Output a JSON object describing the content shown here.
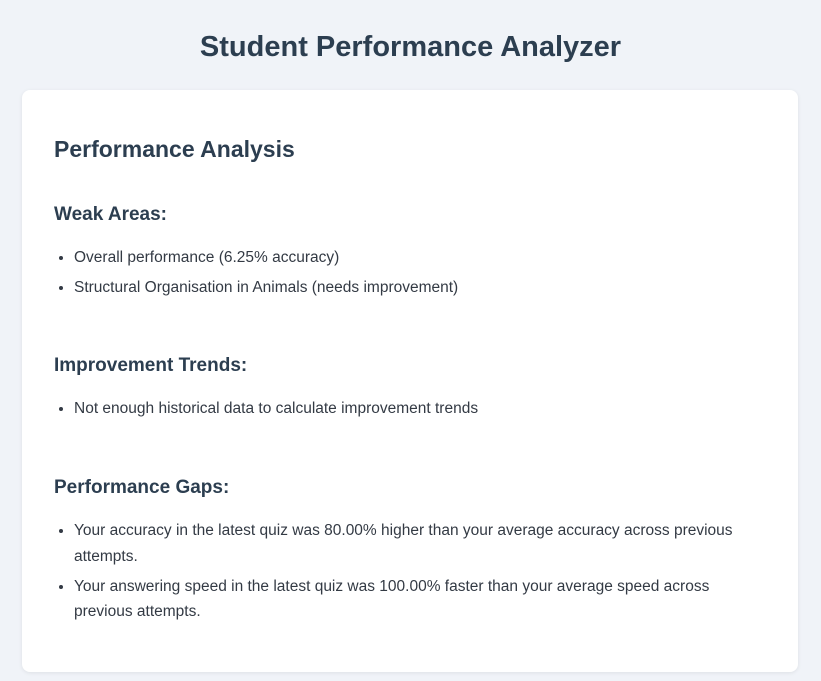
{
  "app": {
    "title": "Student Performance Analyzer"
  },
  "analysis": {
    "title": "Performance Analysis",
    "weak_areas": {
      "heading": "Weak Areas:",
      "items": [
        "Overall performance (6.25% accuracy)",
        "Structural Organisation in Animals (needs improvement)"
      ]
    },
    "improvement_trends": {
      "heading": "Improvement Trends:",
      "items": [
        "Not enough historical data to calculate improvement trends"
      ]
    },
    "performance_gaps": {
      "heading": "Performance Gaps:",
      "items": [
        "Your accuracy in the latest quiz was 80.00% higher than your average accuracy across previous attempts.",
        "Your answering speed in the latest quiz was 100.00% faster than your average speed across previous attempts."
      ]
    }
  },
  "colors": {
    "page_background": "#f0f3f8",
    "card_background": "#ffffff",
    "heading_text": "#2c3e50",
    "body_text": "#333a44"
  }
}
